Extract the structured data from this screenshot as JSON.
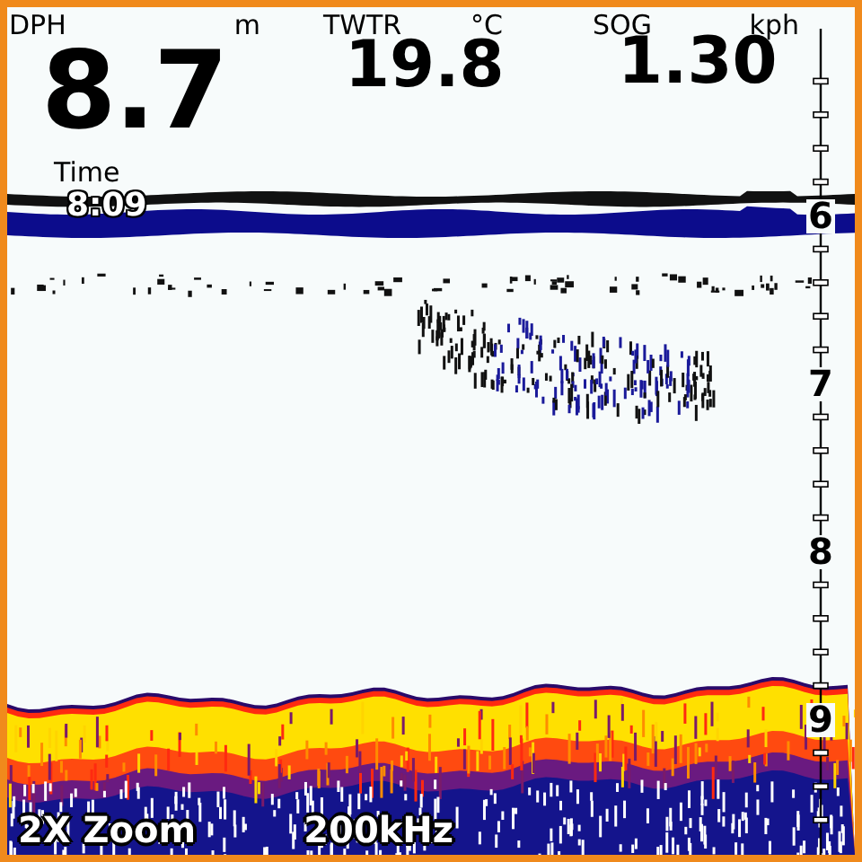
{
  "readouts": [
    {
      "label": "DPH",
      "unit": "m",
      "value": "8.7",
      "kind": "primary"
    },
    {
      "label": "TWTR",
      "unit": "°C",
      "value": "19.8",
      "kind": "secondary"
    },
    {
      "label": "SOG",
      "unit": "kph",
      "value": "1.30",
      "kind": "secondary"
    }
  ],
  "time": {
    "label": "Time",
    "value": "8:09"
  },
  "depth_scale": {
    "labels": [
      "6",
      "7",
      "8",
      "9"
    ]
  },
  "status": {
    "zoom": "2X Zoom",
    "frequency": "200kHz"
  }
}
